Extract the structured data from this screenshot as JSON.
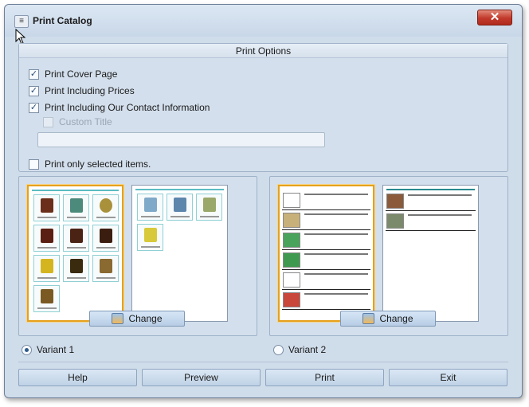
{
  "window": {
    "title": "Print Catalog",
    "close_glyph": "✕",
    "menu_glyph": "≡"
  },
  "options": {
    "header": "Print Options",
    "print_cover_page": {
      "label": "Print Cover Page",
      "checked": true
    },
    "print_including_prices": {
      "label": "Print Including Prices",
      "checked": true
    },
    "print_contact_info": {
      "label": "Print Including Our Contact Information",
      "checked": true
    },
    "custom_title": {
      "label": "Custom Title",
      "checked": false,
      "enabled": false,
      "value": ""
    },
    "print_selected_only": {
      "label": "Print only selected items.",
      "checked": false
    }
  },
  "variants": [
    {
      "label": "Variant 1",
      "selected": true,
      "change_label": "Change"
    },
    {
      "label": "Variant 2",
      "selected": false,
      "change_label": "Change"
    }
  ],
  "buttons": {
    "help": "Help",
    "preview": "Preview",
    "print": "Print",
    "exit": "Exit"
  },
  "colors": {
    "window_bg": "#cfdcea",
    "selected_page_border": "#e5a11d",
    "close_red": "#c0392b"
  }
}
